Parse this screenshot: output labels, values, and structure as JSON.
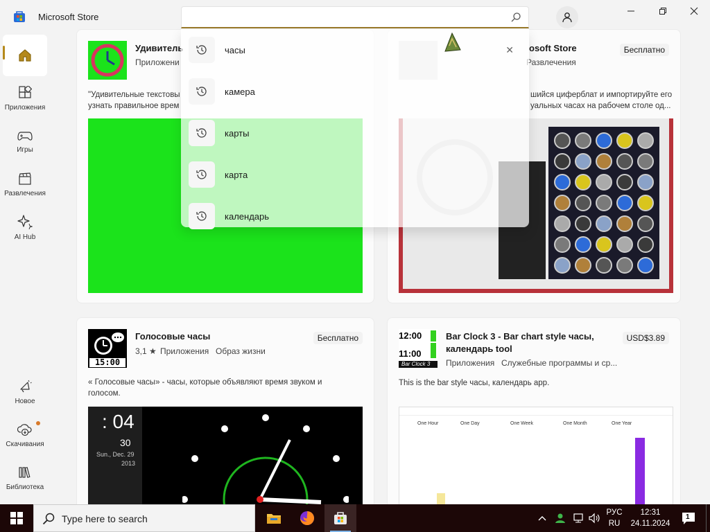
{
  "app": {
    "title": "Microsoft Store"
  },
  "search": {
    "value": "",
    "placeholder": ""
  },
  "suggestions": [
    {
      "text": "часы"
    },
    {
      "text": "камера"
    },
    {
      "text": "карты"
    },
    {
      "text": "карта"
    },
    {
      "text": "календарь"
    }
  ],
  "sidebar": {
    "items": [
      {
        "label": ""
      },
      {
        "label": "Приложения"
      },
      {
        "label": "Игры"
      },
      {
        "label": "Развлечения"
      },
      {
        "label": "AI Hub"
      },
      {
        "label": "Новое"
      },
      {
        "label": "Скачивания"
      },
      {
        "label": "Библиотека"
      }
    ]
  },
  "cards": {
    "card1": {
      "name": "Удивитель",
      "meta": "Приложени",
      "desc1": "\"Удивительные текстовы",
      "desc2": "узнать правильное врем",
      "color": "#1be31b"
    },
    "card2": {
      "name": "osoft Store",
      "meta": "Развлечения",
      "price": "Бесплатно",
      "desc1": "шийся циферблат и импортируйте его",
      "desc2": "уальных часах на рабочем столе од..."
    },
    "card3": {
      "name": "Голосовые часы",
      "rating": "3,1 ★",
      "cat1": "Приложения",
      "cat2": "Образ жизни",
      "price": "Бесплатно",
      "desc1": "« Голосовые часы» - часы, которые объявляют время звуком и",
      "desc2": "голосом.",
      "shot_time": ": 04",
      "shot_num": "30",
      "shot_date": "Sun., Dec. 29",
      "shot_year": "2013",
      "icon_time": "15:00"
    },
    "card4": {
      "name1": "Bar Clock 3 - Bar chart style часы,",
      "name2": "календарь tool",
      "cat1": "Приложения",
      "cat2": "Служебные программы и ср...",
      "price": "USD$3.89",
      "desc": "This is the bar style часы, календарь app.",
      "icon_t1": "12:00",
      "icon_t2": "11:00",
      "icon_sub": "Bar Clock 3",
      "shot_cols": [
        "One Hour",
        "One Day",
        "One Week",
        "One Month",
        "One Year"
      ]
    }
  },
  "taskbar": {
    "search_placeholder": "Type here to search",
    "lang_top": "РУС",
    "lang_bottom": "RU",
    "time": "12:31",
    "date": "24.11.2024",
    "notif_count": "1"
  },
  "colors": {
    "accent": "#b5891b",
    "taskbar": "#1c0707"
  }
}
